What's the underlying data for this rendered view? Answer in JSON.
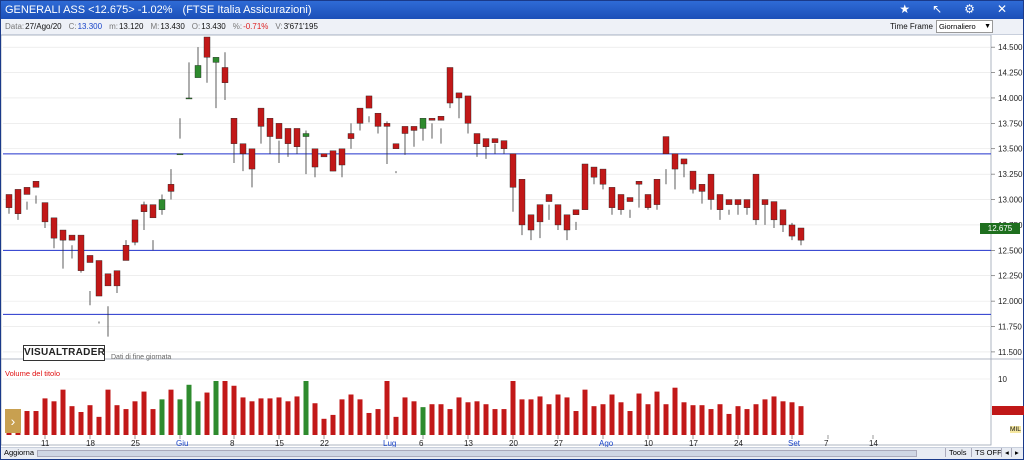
{
  "window": {
    "title": "GENERALI ASS <12.675> -1.02%",
    "market": "(FTSE Italia Assicurazioni)"
  },
  "info": {
    "date_label": "Data:",
    "date": "27/Ago/20",
    "close_label": "C:",
    "close": "13.300",
    "min_label": "m:",
    "min": "13.120",
    "max_label": "M:",
    "max": "13.430",
    "open_label": "O:",
    "open": "13.430",
    "pct_label": "%:",
    "pct": "-0.71%",
    "vol_label": "V:",
    "vol": "3'671'195"
  },
  "timeframe": {
    "label": "Time Frame",
    "selected": "Giornaliero"
  },
  "branding": {
    "logo": "VISUALTRADER",
    "subtitle": "Dati di fine giornata"
  },
  "volume_panel": {
    "title": "Volume del titolo",
    "scale_label": "10",
    "unit": "MIL"
  },
  "last_price_tag": "12.675",
  "bottom": {
    "update": "Aggiorna",
    "tools": "Tools",
    "ts": "TS OFF"
  },
  "colors": {
    "up": "#2e8b2e",
    "down": "#c21818",
    "hline": "#2233cc",
    "grid": "#e3e3e3"
  },
  "chart_data": {
    "type": "candlestick",
    "ylim": [
      11.45,
      14.6
    ],
    "yticks": [
      "14.500",
      "14.250",
      "14.000",
      "13.750",
      "13.500",
      "13.250",
      "13.000",
      "12.750",
      "12.500",
      "12.250",
      "12.000",
      "11.750",
      "11.500"
    ],
    "xticks": [
      {
        "label": "11",
        "i": 4
      },
      {
        "label": "18",
        "i": 9
      },
      {
        "label": "25",
        "i": 14
      },
      {
        "label": "Giu",
        "i": 19
      },
      {
        "label": "8",
        "i": 25
      },
      {
        "label": "15",
        "i": 30
      },
      {
        "label": "22",
        "i": 35
      },
      {
        "label": "Lug",
        "i": 42
      },
      {
        "label": "6",
        "i": 46
      },
      {
        "label": "13",
        "i": 51
      },
      {
        "label": "20",
        "i": 56
      },
      {
        "label": "27",
        "i": 61
      },
      {
        "label": "Ago",
        "i": 66
      },
      {
        "label": "10",
        "i": 71
      },
      {
        "label": "17",
        "i": 76
      },
      {
        "label": "24",
        "i": 81
      },
      {
        "label": "Set",
        "i": 87
      },
      {
        "label": "7",
        "i": 91
      },
      {
        "label": "14",
        "i": 96
      }
    ],
    "hlines": [
      13.45,
      12.5,
      11.87
    ],
    "candles": [
      [
        13.05,
        12.95,
        12.86,
        12.92
      ],
      [
        13.1,
        12.88,
        12.8,
        12.86
      ],
      [
        13.12,
        12.98,
        12.9,
        13.05
      ],
      [
        13.18,
        13.04,
        12.96,
        13.12
      ],
      [
        12.97,
        12.93,
        12.72,
        12.78
      ],
      [
        12.82,
        12.7,
        12.52,
        12.62
      ],
      [
        12.7,
        12.62,
        12.32,
        12.6
      ],
      [
        12.65,
        12.55,
        12.42,
        12.6
      ],
      [
        12.65,
        12.35,
        12.28,
        12.3
      ],
      [
        12.45,
        12.1,
        11.96,
        12.38
      ],
      [
        12.4,
        11.8,
        11.78,
        12.05
      ],
      [
        12.27,
        11.95,
        11.65,
        12.15
      ],
      [
        12.3,
        12.22,
        12.08,
        12.15
      ],
      [
        12.55,
        12.6,
        12.5,
        12.4
      ],
      [
        12.8,
        12.73,
        12.55,
        12.58
      ],
      [
        12.95,
        12.98,
        12.7,
        12.88
      ],
      [
        12.95,
        12.6,
        12.5,
        12.82
      ],
      [
        12.9,
        13.05,
        12.85,
        13.0
      ],
      [
        13.15,
        13.3,
        13.0,
        13.08
      ],
      [
        13.45,
        13.8,
        13.6,
        13.45
      ],
      [
        14.0,
        14.35,
        14.0,
        14.0
      ],
      [
        14.2,
        14.5,
        14.32,
        14.32
      ],
      [
        14.6,
        14.42,
        14.15,
        14.4
      ],
      [
        14.35,
        14.38,
        13.9,
        14.4
      ],
      [
        14.3,
        14.45,
        13.98,
        14.15
      ],
      [
        13.8,
        13.7,
        13.36,
        13.55
      ],
      [
        13.55,
        13.5,
        13.28,
        13.45
      ],
      [
        13.5,
        13.3,
        13.12,
        13.3
      ],
      [
        13.9,
        13.76,
        13.55,
        13.72
      ],
      [
        13.8,
        13.66,
        13.45,
        13.62
      ],
      [
        13.75,
        13.58,
        13.36,
        13.6
      ],
      [
        13.7,
        13.6,
        13.42,
        13.55
      ],
      [
        13.7,
        13.68,
        13.45,
        13.52
      ],
      [
        13.62,
        13.68,
        13.25,
        13.65
      ],
      [
        13.5,
        13.38,
        13.22,
        13.32
      ],
      [
        13.45,
        13.3,
        13.3,
        13.42
      ],
      [
        13.48,
        13.32,
        13.28,
        13.28
      ],
      [
        13.5,
        13.42,
        13.22,
        13.34
      ],
      [
        13.65,
        13.75,
        13.5,
        13.6
      ],
      [
        13.9,
        13.88,
        13.68,
        13.75
      ],
      [
        14.02,
        13.82,
        13.76,
        13.9
      ],
      [
        13.85,
        13.75,
        13.65,
        13.72
      ],
      [
        13.75,
        13.77,
        13.35,
        13.72
      ],
      [
        13.55,
        13.28,
        13.26,
        13.5
      ],
      [
        13.72,
        13.66,
        13.44,
        13.65
      ],
      [
        13.72,
        13.7,
        13.52,
        13.68
      ],
      [
        13.7,
        13.7,
        13.58,
        13.8
      ],
      [
        13.8,
        13.75,
        13.6,
        13.78
      ],
      [
        13.82,
        13.7,
        13.55,
        13.78
      ],
      [
        14.3,
        14.0,
        13.9,
        13.95
      ],
      [
        14.05,
        14.02,
        13.8,
        14.0
      ],
      [
        14.02,
        13.82,
        13.65,
        13.75
      ],
      [
        13.65,
        13.6,
        13.42,
        13.55
      ],
      [
        13.6,
        13.55,
        13.4,
        13.52
      ],
      [
        13.6,
        13.55,
        13.45,
        13.56
      ],
      [
        13.58,
        13.55,
        13.45,
        13.5
      ],
      [
        13.45,
        13.45,
        12.88,
        13.12
      ],
      [
        13.2,
        12.85,
        12.65,
        12.75
      ],
      [
        12.85,
        12.8,
        12.6,
        12.7
      ],
      [
        12.95,
        12.85,
        12.62,
        12.78
      ],
      [
        13.05,
        12.95,
        12.8,
        12.98
      ],
      [
        12.95,
        12.95,
        12.7,
        12.75
      ],
      [
        12.85,
        12.82,
        12.6,
        12.7
      ],
      [
        12.9,
        12.78,
        12.7,
        12.85
      ],
      [
        13.35,
        13.25,
        12.95,
        12.9
      ],
      [
        13.32,
        13.28,
        13.15,
        13.22
      ],
      [
        13.3,
        13.25,
        13.1,
        13.15
      ],
      [
        13.12,
        13.1,
        12.85,
        12.92
      ],
      [
        13.05,
        13.02,
        12.85,
        12.9
      ],
      [
        13.02,
        12.9,
        12.82,
        12.98
      ],
      [
        13.18,
        13.18,
        12.92,
        13.15
      ],
      [
        13.05,
        13.05,
        12.9,
        12.92
      ],
      [
        13.2,
        13.18,
        12.9,
        12.95
      ],
      [
        13.62,
        13.3,
        13.15,
        13.45
      ],
      [
        13.45,
        13.42,
        13.1,
        13.3
      ],
      [
        13.4,
        13.39,
        13.22,
        13.35
      ],
      [
        13.28,
        13.2,
        13.06,
        13.1
      ],
      [
        13.15,
        13.1,
        12.96,
        13.08
      ],
      [
        13.25,
        13.0,
        12.9,
        13.0
      ],
      [
        13.05,
        12.95,
        12.8,
        12.9
      ],
      [
        13.0,
        12.9,
        12.85,
        12.95
      ],
      [
        13.0,
        12.98,
        12.85,
        12.95
      ],
      [
        13.0,
        12.95,
        12.85,
        12.92
      ],
      [
        13.25,
        12.9,
        12.75,
        12.8
      ],
      [
        13.0,
        12.95,
        12.75,
        12.95
      ],
      [
        12.98,
        12.95,
        12.72,
        12.8
      ],
      [
        12.9,
        12.86,
        12.68,
        12.75
      ],
      [
        12.75,
        12.77,
        12.6,
        12.64
      ],
      [
        12.72,
        12.68,
        12.55,
        12.6
      ]
    ]
  }
}
